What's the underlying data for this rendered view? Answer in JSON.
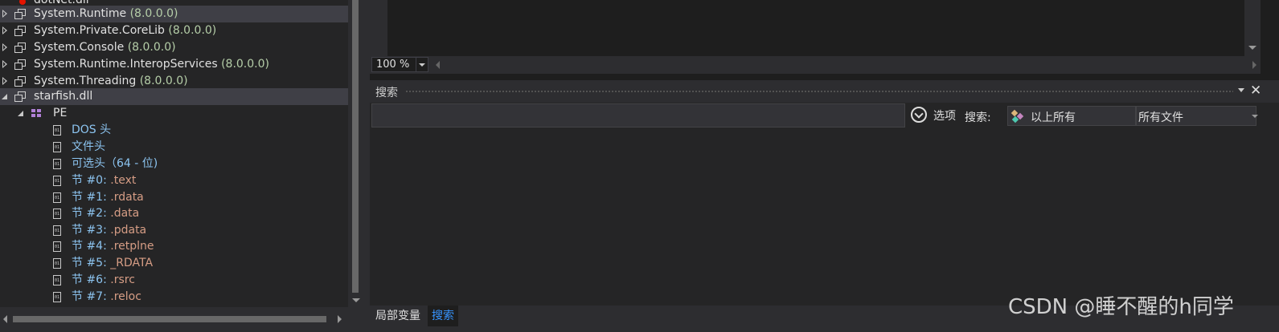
{
  "tree": {
    "rows": [
      {
        "name": "dotNet.dll",
        "version": ""
      },
      {
        "name": "System.Runtime",
        "version": "(8.0.0.0)"
      },
      {
        "name": "System.Private.CoreLib",
        "version": "(8.0.0.0)"
      },
      {
        "name": "System.Console",
        "version": "(8.0.0.0)"
      },
      {
        "name": "System.Runtime.InteropServices",
        "version": "(8.0.0.0)"
      },
      {
        "name": "System.Threading",
        "version": "(8.0.0.0)"
      },
      {
        "name": "starfish.dll",
        "version": ""
      },
      {
        "name": "PE"
      },
      {
        "name": "DOS 头"
      },
      {
        "name": "文件头"
      },
      {
        "name": "可选头（64 - 位)"
      },
      {
        "prefix": "节 #0:",
        "name": ".text"
      },
      {
        "prefix": "节 #1:",
        "name": ".rdata"
      },
      {
        "prefix": "节 #2:",
        "name": ".data"
      },
      {
        "prefix": "节 #3:",
        "name": ".pdata"
      },
      {
        "prefix": "节 #4:",
        "name": ".retplne"
      },
      {
        "prefix": "节 #5:",
        "name": "_RDATA"
      },
      {
        "prefix": "节 #6:",
        "name": ".rsrc"
      },
      {
        "prefix": "节 #7:",
        "name": ".reloc"
      }
    ]
  },
  "editor": {
    "zoom": "100 %"
  },
  "search_panel": {
    "title": "搜索",
    "query": "",
    "options_label": "选项",
    "search_in_label": "搜索:",
    "scope_value": "以上所有",
    "type_value": "所有文件"
  },
  "bottom_tabs": [
    {
      "label": "局部变量"
    },
    {
      "label": "搜索"
    }
  ],
  "watermark": "CSDN @睡不醒的h同学",
  "colors": {
    "background": "#1e1e1e",
    "panel": "#252526",
    "selected_row": "#3f3f46",
    "version_text": "#b5cea8",
    "link_text": "#8cc4f0",
    "section_name": "#d69d85",
    "active_tab": "#3794ff"
  },
  "icons": {
    "assembly": "assembly-reference-icon",
    "pe": "pe-module-icon",
    "file": "binary-file-icon",
    "options": "chevron-circle-down-icon",
    "scope": "scope-icon",
    "close": "close-icon",
    "pin": "dropdown-pin-icon"
  }
}
